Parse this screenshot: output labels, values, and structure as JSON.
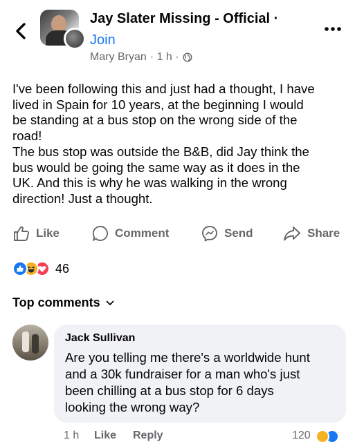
{
  "header": {
    "group_name": "Jay Slater Missing - Official ·",
    "join_label": "Join",
    "author": "Mary Bryan",
    "time": "· 1 h ·",
    "icons": {
      "back": "chevron-left-icon",
      "privacy": "globe-icon",
      "more": "more-dots-icon"
    }
  },
  "post": {
    "lines": [
      "I've been following this and just had a thought, I have",
      "lived in Spain for 10 years, at the beginning I would",
      "be standing at a bus stop on the wrong side of the",
      "road!",
      "The bus stop was outside the B&B, did Jay think the",
      "bus would be going the same way as it does in the",
      "UK. And this is why he was walking in the wrong",
      "direction! Just a thought."
    ]
  },
  "actions": {
    "like": "Like",
    "comment": "Comment",
    "send": "Send",
    "share": "Share"
  },
  "reactions": {
    "count": "46",
    "types": [
      "like",
      "haha",
      "love"
    ]
  },
  "comments_section": {
    "sort_label": "Top comments"
  },
  "comment": {
    "author": "Jack Sullivan",
    "lines": [
      "Are you telling me there's a worldwide hunt",
      "and a 30k fundraiser for a man who's just",
      "been chilling at a bus stop for 6 days",
      "looking the wrong way?"
    ],
    "time": "1 h",
    "like_label": "Like",
    "reply_label": "Reply",
    "reaction_count": "120"
  },
  "colors": {
    "accent": "#1877f2",
    "secondary_text": "#65676b",
    "bubble": "#f0f2f5",
    "like": "#1877f2",
    "haha": "#f7b125",
    "love": "#f33e58"
  }
}
